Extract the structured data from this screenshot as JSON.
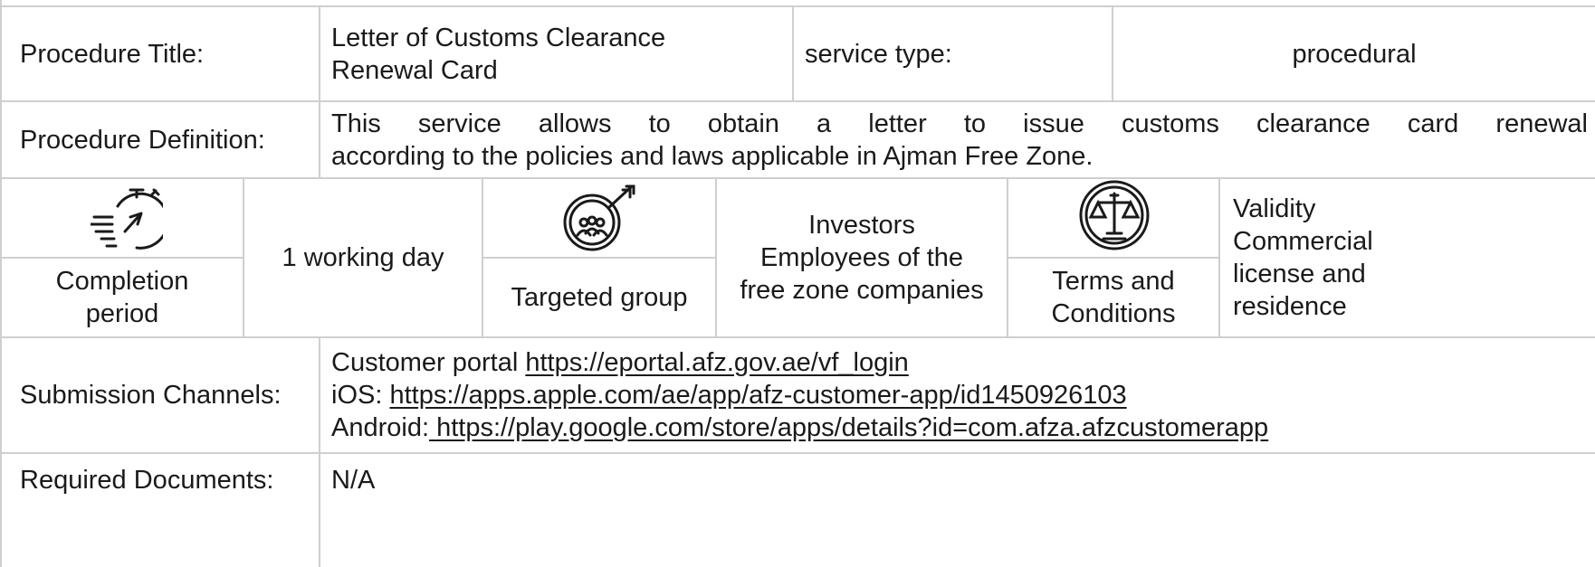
{
  "procedure": {
    "title_label": "Procedure Title:",
    "title_value_line1": "Letter of Customs Clearance",
    "title_value_line2": "Renewal Card",
    "service_type_label": "service type:",
    "service_type_value": "procedural",
    "definition_label": "Procedure Definition:",
    "definition_line1": "This service allows to obtain a letter to issue customs clearance card renewal",
    "definition_line2": "according to the policies and laws applicable in Ajman Free Zone."
  },
  "summary": {
    "completion_icon": "stopwatch-icon",
    "completion_label_line1": "Completion",
    "completion_label_line2": "period",
    "completion_value": "1 working day",
    "target_icon": "target-group-icon",
    "target_label": "Targeted group",
    "target_value_line1": "Investors",
    "target_value_line2": "Employees of the",
    "target_value_line3": "free zone companies",
    "terms_icon": "scales-icon",
    "terms_label_line1": "Terms and",
    "terms_label_line2": "Conditions",
    "terms_value_line1": "Validity",
    "terms_value_line2": "Commercial",
    "terms_value_line3": "license and",
    "terms_value_line4": "residence"
  },
  "submission": {
    "label": "Submission Channels:",
    "portal_prefix": "Customer portal ",
    "portal_url": "https://eportal.afz.gov.ae/vf_login",
    "ios_prefix": "iOS: ",
    "ios_url": "https://apps.apple.com/ae/app/afz-customer-app/id1450926103",
    "android_prefix": "Android:",
    "android_url": " https://play.google.com/store/apps/details?id=com.afza.afzcustomerapp"
  },
  "documents": {
    "label": "Required Documents:",
    "value": "N/A"
  },
  "colors": {
    "border": "#cfcfcf",
    "text": "#1a1a1a"
  }
}
